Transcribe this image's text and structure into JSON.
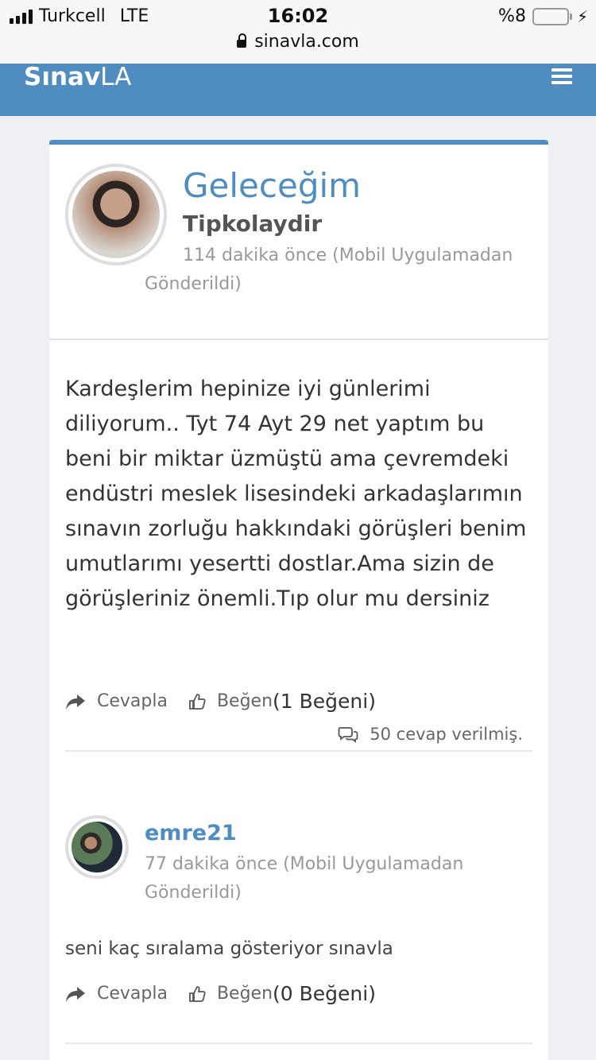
{
  "status_bar": {
    "carrier": "Turkcell",
    "network": "LTE",
    "time": "16:02",
    "battery_text": "%8",
    "battery_level": 0.08,
    "battery_color": "#e53a3a",
    "url": "sinavla.com"
  },
  "header": {
    "logo_bold": "Sınav",
    "logo_light": "LA",
    "bg_color": "#4f8cc0"
  },
  "post": {
    "title": "Geleceğim",
    "author": "Tipkolaydir",
    "meta": "114 dakika önce (Mobil Uygulamadan Gönderildi)",
    "body": "Kardeşlerim hepinize iyi günlerimi diliyorum.. Tyt 74 Ayt 29 net yaptım bu beni bir miktar üzmüştü ama çevremdeki endüstri meslek lisesindeki arkadaşlarımın sınavın zorluğu hakkındaki görüşleri benim umutlarımı yesertti dostlar.Ama sizin de görüşleriniz önemli.Tıp olur mu dersiniz",
    "reply_label": "Cevapla",
    "like_label": "Beğen",
    "like_count": "(1 Beğeni)",
    "replies_count": "50 cevap verilmiş."
  },
  "reply": {
    "user": "emre21",
    "meta": "77 dakika önce (Mobil Uygulamadan Gönderildi)",
    "body": "seni kaç sıralama  gösteriyor sınavla",
    "reply_label": "Cevapla",
    "like_label": "Beğen",
    "like_count": " (0 Beğeni)"
  }
}
